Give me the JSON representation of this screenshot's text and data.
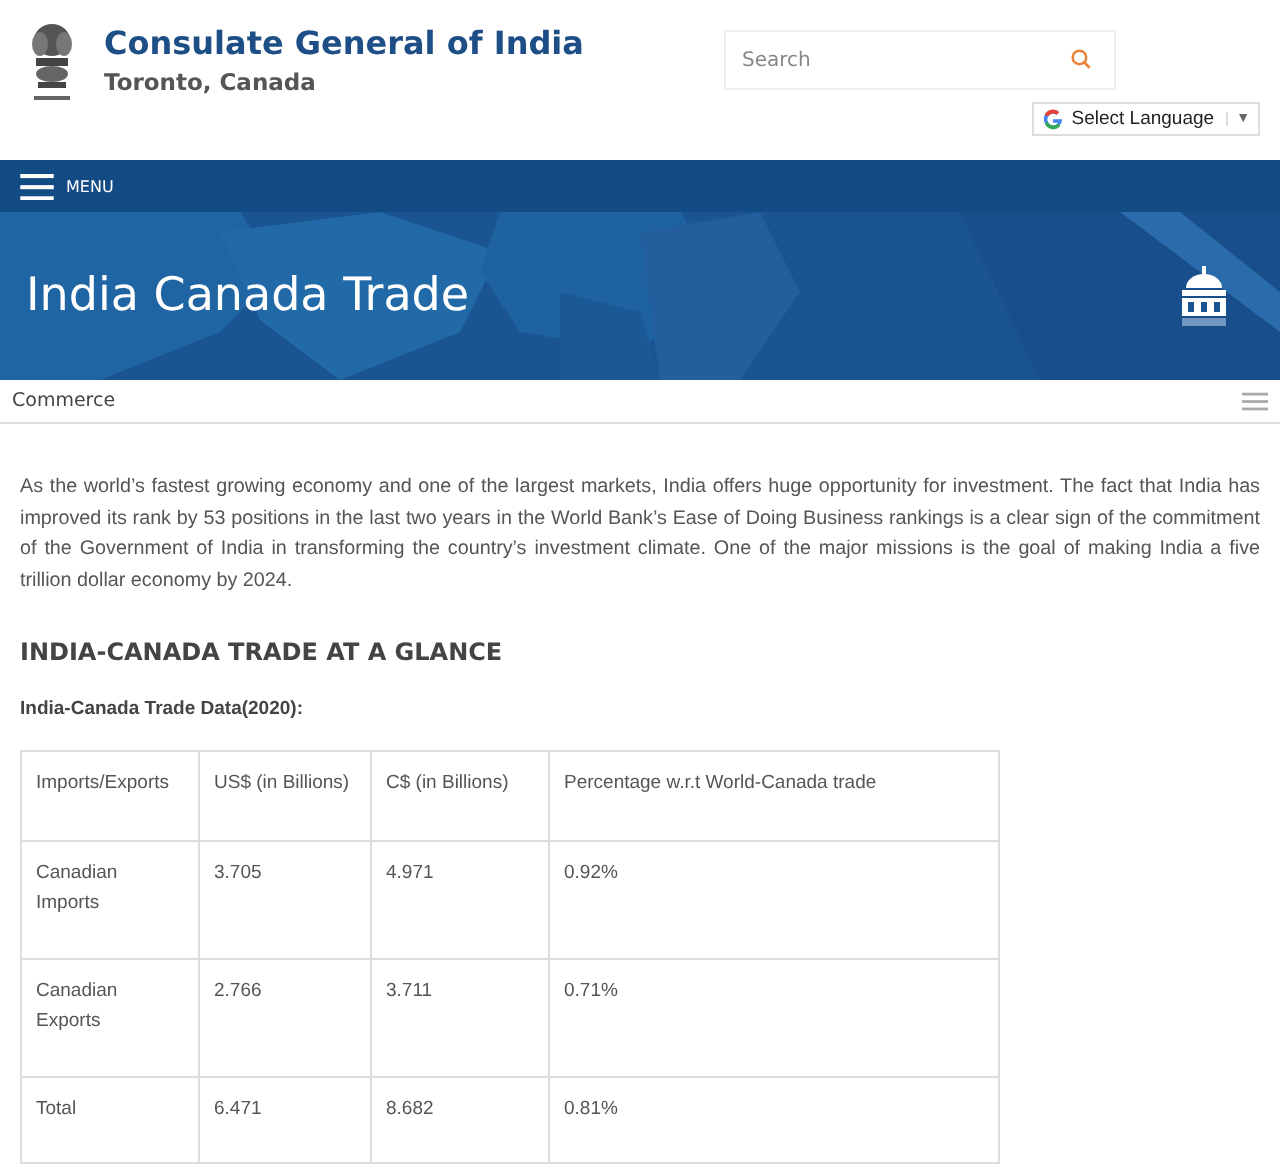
{
  "header": {
    "title": "Consulate General of India",
    "subtitle": "Toronto, Canada",
    "search": {
      "placeholder": "Search"
    },
    "language": {
      "label": "Select Language",
      "caret": "▼"
    }
  },
  "nav": {
    "menu_label": "MENU"
  },
  "banner": {
    "title": "India Canada Trade"
  },
  "breadcrumb": {
    "label": "Commerce"
  },
  "intro": "As the world’s fastest growing economy and one of the largest markets, India offers huge opportunity for investment. The fact that India has improved its rank by 53 positions in the last two years in the World Bank’s Ease of Doing Business rankings is a clear sign of the commitment of the Government of India in transforming the country’s investment climate. One of the major missions is the goal of making India a five trillion dollar economy by 2024.",
  "section_heading": "INDIA-CANADA TRADE AT A GLANCE",
  "table_caption": "India-Canada Trade Data(2020):",
  "table": {
    "columns": [
      "Imports/Exports",
      "US$ (in Billions)",
      "C$ (in Billions)",
      "Percentage w.r.t  World-Canada trade"
    ],
    "rows": [
      [
        "Canadian Imports",
        "3.705",
        "4.971",
        "0.92%"
      ],
      [
        "Canadian Exports",
        "2.766",
        "3.711",
        "0.71%"
      ],
      [
        "Total",
        "6.471",
        "8.682",
        "0.81%"
      ]
    ]
  }
}
